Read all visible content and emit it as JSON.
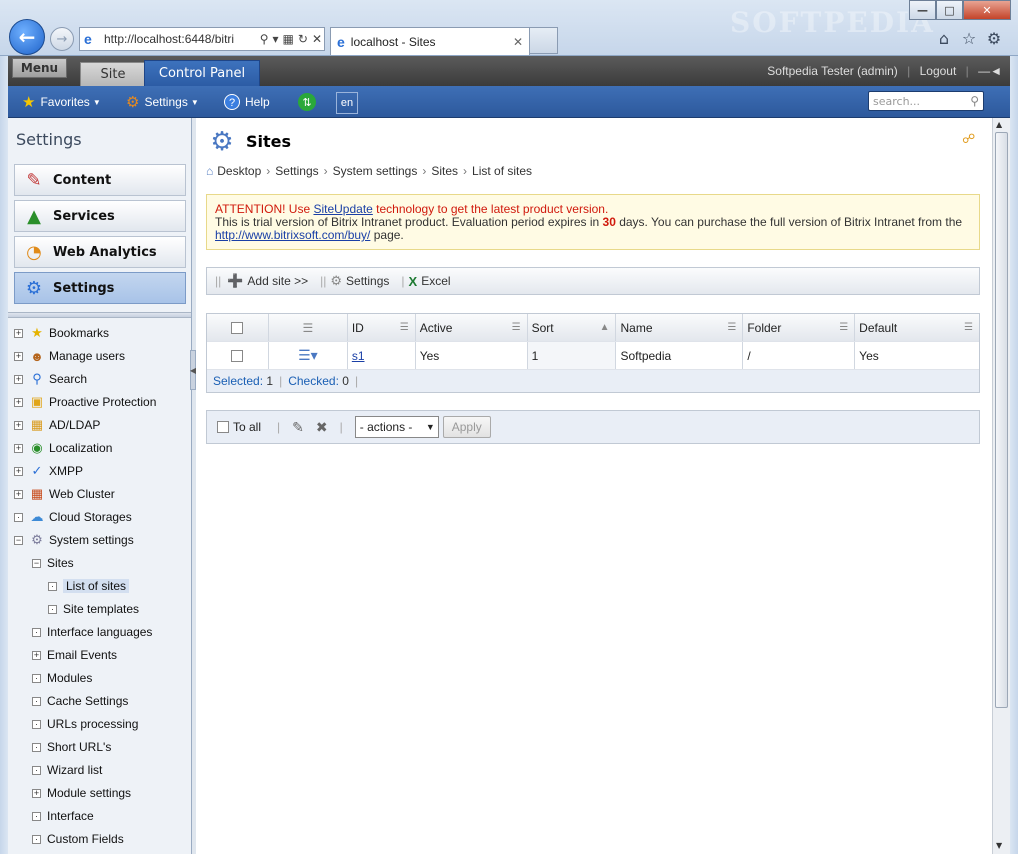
{
  "browser": {
    "address": "http://localhost:6448/bitri",
    "tab_title": "localhost - Sites",
    "watermark": "SOFTPEDIA"
  },
  "header": {
    "menu_label": "Menu",
    "tabs": [
      {
        "label": "Site"
      },
      {
        "label": "Control Panel"
      }
    ],
    "user": "Softpedia Tester (admin)",
    "logout": "Logout"
  },
  "toolbar": {
    "favorites": "Favorites",
    "settings": "Settings",
    "help": "Help",
    "lang": "en",
    "search_placeholder": "search..."
  },
  "sidebar": {
    "title": "Settings",
    "main_buttons": [
      {
        "label": "Content"
      },
      {
        "label": "Services"
      },
      {
        "label": "Web Analytics"
      },
      {
        "label": "Settings"
      }
    ],
    "tree": [
      {
        "label": "Bookmarks",
        "exp": "+"
      },
      {
        "label": "Manage users",
        "exp": "+"
      },
      {
        "label": "Search",
        "exp": "+"
      },
      {
        "label": "Proactive Protection",
        "exp": "+"
      },
      {
        "label": "AD/LDAP",
        "exp": "+"
      },
      {
        "label": "Localization",
        "exp": "+"
      },
      {
        "label": "XMPP",
        "exp": "+"
      },
      {
        "label": "Web Cluster",
        "exp": "+"
      },
      {
        "label": "Cloud Storages",
        "exp": "·"
      },
      {
        "label": "System settings",
        "exp": "−"
      },
      {
        "label": "Sites",
        "exp": "−"
      },
      {
        "label": "List of sites",
        "exp": "·"
      },
      {
        "label": "Site templates",
        "exp": "·"
      },
      {
        "label": "Interface languages",
        "exp": "·"
      },
      {
        "label": "Email Events",
        "exp": "+"
      },
      {
        "label": "Modules",
        "exp": "·"
      },
      {
        "label": "Cache Settings",
        "exp": "·"
      },
      {
        "label": "URLs processing",
        "exp": "·"
      },
      {
        "label": "Short URL's",
        "exp": "·"
      },
      {
        "label": "Wizard list",
        "exp": "·"
      },
      {
        "label": "Module settings",
        "exp": "+"
      },
      {
        "label": "Interface",
        "exp": "·"
      },
      {
        "label": "Custom Fields",
        "exp": "·"
      }
    ]
  },
  "main": {
    "title": "Sites",
    "breadcrumb": [
      "Desktop",
      "Settings",
      "System settings",
      "Sites",
      "List of sites"
    ],
    "notice": {
      "attention_prefix": "ATTENTION! Use ",
      "siteupdate": "SiteUpdate",
      "attention_suffix": " technology to get the latest product version.",
      "trial_prefix": "This is trial version of Bitrix Intranet product. Evaluation period expires in ",
      "days": "30",
      "trial_suffix": " days. You can purchase the full version of Bitrix Intranet from the ",
      "url": "http://www.bitrixsoft.com/buy/",
      "page": " page."
    },
    "list_toolbar": {
      "add_site": "Add site >>",
      "settings": "Settings",
      "excel": "Excel"
    },
    "grid": {
      "columns": [
        "ID",
        "Active",
        "Sort",
        "Name",
        "Folder",
        "Default"
      ],
      "rows": [
        {
          "id": "s1",
          "active": "Yes",
          "sort": "1",
          "name": "Softpedia",
          "folder": "/",
          "default": "Yes"
        }
      ],
      "selected_label": "Selected:",
      "selected_count": "1",
      "checked_label": "Checked:",
      "checked_count": "0"
    },
    "actions": {
      "to_all": "To all",
      "select_value": "- actions -",
      "apply": "Apply"
    }
  }
}
